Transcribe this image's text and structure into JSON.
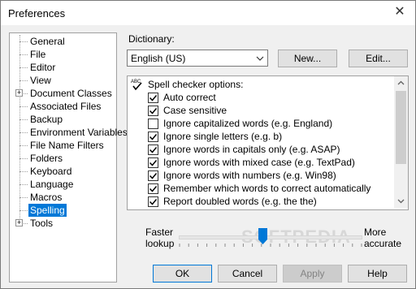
{
  "window": {
    "title": "Preferences",
    "close_glyph": "✕"
  },
  "tree": {
    "items": [
      {
        "label": "General",
        "expandable": false,
        "selected": false
      },
      {
        "label": "File",
        "expandable": false,
        "selected": false
      },
      {
        "label": "Editor",
        "expandable": false,
        "selected": false
      },
      {
        "label": "View",
        "expandable": false,
        "selected": false
      },
      {
        "label": "Document Classes",
        "expandable": true,
        "selected": false
      },
      {
        "label": "Associated Files",
        "expandable": false,
        "selected": false
      },
      {
        "label": "Backup",
        "expandable": false,
        "selected": false
      },
      {
        "label": "Environment Variables",
        "expandable": false,
        "selected": false
      },
      {
        "label": "File Name Filters",
        "expandable": false,
        "selected": false
      },
      {
        "label": "Folders",
        "expandable": false,
        "selected": false
      },
      {
        "label": "Keyboard",
        "expandable": false,
        "selected": false
      },
      {
        "label": "Language",
        "expandable": false,
        "selected": false
      },
      {
        "label": "Macros",
        "expandable": false,
        "selected": false
      },
      {
        "label": "Spelling",
        "expandable": false,
        "selected": true
      },
      {
        "label": "Tools",
        "expandable": true,
        "selected": false
      }
    ]
  },
  "dictionary": {
    "label": "Dictionary:",
    "value": "English (US)",
    "new_button": "New...",
    "edit_button": "Edit..."
  },
  "options": {
    "header": "Spell checker options:",
    "items": [
      {
        "label": "Auto correct",
        "checked": true
      },
      {
        "label": "Case sensitive",
        "checked": true
      },
      {
        "label": "Ignore capitalized words (e.g. England)",
        "checked": false
      },
      {
        "label": "Ignore single letters (e.g. b)",
        "checked": true
      },
      {
        "label": "Ignore words in capitals only (e.g. ASAP)",
        "checked": true
      },
      {
        "label": "Ignore words with mixed case (e.g. TextPad)",
        "checked": true
      },
      {
        "label": "Ignore words with numbers (e.g. Win98)",
        "checked": true
      },
      {
        "label": "Remember which words to correct automatically",
        "checked": true
      },
      {
        "label": "Report doubled words (e.g. the the)",
        "checked": true
      }
    ]
  },
  "slider": {
    "left_line1": "Faster",
    "left_line2": "lookup",
    "right_line1": "More",
    "right_line2": "accurate",
    "level": 0.46
  },
  "watermark": "SOFTPEDIA",
  "buttons": {
    "ok": "OK",
    "cancel": "Cancel",
    "apply": "Apply",
    "help": "Help"
  },
  "colors": {
    "selection": "#0078d7",
    "accent": "#0078d7"
  }
}
